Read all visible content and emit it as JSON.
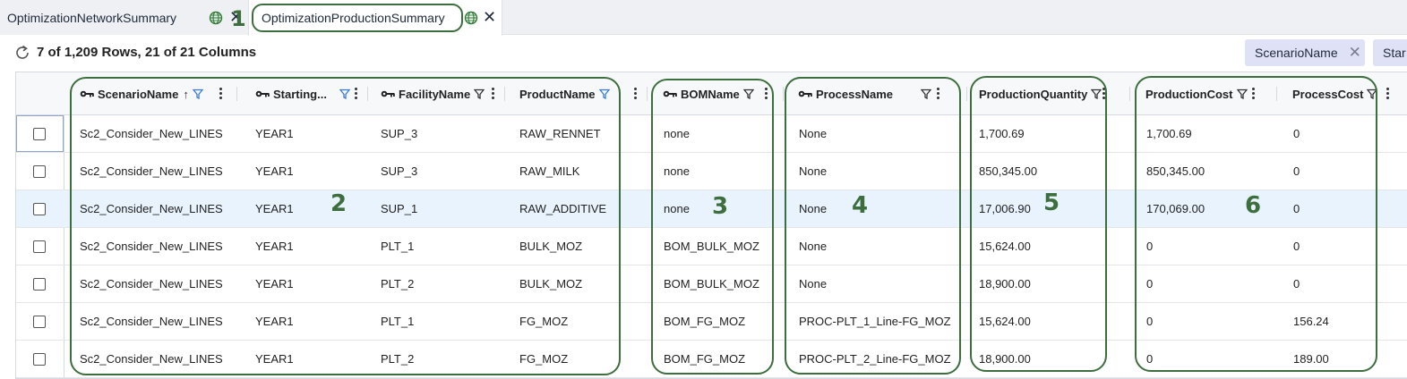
{
  "tabs": [
    {
      "label": "OptimizationNetworkSummary"
    },
    {
      "label": "OptimizationProductionSummary"
    }
  ],
  "toolbar": {
    "row_info": "7 of 1,209 Rows, 21 of 21 Columns",
    "chips": [
      {
        "label": "ScenarioName"
      },
      {
        "label": "Star"
      }
    ]
  },
  "grid": {
    "columns": [
      {
        "label": "ScenarioName"
      },
      {
        "label": "Starting..."
      },
      {
        "label": "FacilityName"
      },
      {
        "label": "ProductName"
      },
      {
        "label": "BOMName"
      },
      {
        "label": "ProcessName"
      },
      {
        "label": "ProductionQuantity"
      },
      {
        "label": "ProductionCost"
      },
      {
        "label": "ProcessCost"
      }
    ],
    "rows": [
      {
        "cells": [
          "Sc2_Consider_New_LINES",
          "YEAR1",
          "SUP_3",
          "RAW_RENNET",
          "none",
          "None",
          "1,700.69",
          "1,700.69",
          "0"
        ]
      },
      {
        "cells": [
          "Sc2_Consider_New_LINES",
          "YEAR1",
          "SUP_3",
          "RAW_MILK",
          "none",
          "None",
          "850,345.00",
          "850,345.00",
          "0"
        ]
      },
      {
        "cells": [
          "Sc2_Consider_New_LINES",
          "YEAR1",
          "SUP_1",
          "RAW_ADDITIVE",
          "none",
          "None",
          "17,006.90",
          "170,069.00",
          "0"
        ]
      },
      {
        "cells": [
          "Sc2_Consider_New_LINES",
          "YEAR1",
          "PLT_1",
          "BULK_MOZ",
          "BOM_BULK_MOZ",
          "None",
          "15,624.00",
          "0",
          "0"
        ]
      },
      {
        "cells": [
          "Sc2_Consider_New_LINES",
          "YEAR1",
          "PLT_2",
          "BULK_MOZ",
          "BOM_BULK_MOZ",
          "None",
          "18,900.00",
          "0",
          "0"
        ]
      },
      {
        "cells": [
          "Sc2_Consider_New_LINES",
          "YEAR1",
          "PLT_1",
          "FG_MOZ",
          "BOM_FG_MOZ",
          "PROC-PLT_1_Line-FG_MOZ",
          "15,624.00",
          "0",
          "156.24"
        ]
      },
      {
        "cells": [
          "Sc2_Consider_New_LINES",
          "YEAR1",
          "PLT_2",
          "FG_MOZ",
          "BOM_FG_MOZ",
          "PROC-PLT_2_Line-FG_MOZ",
          "18,900.00",
          "0",
          "189.00"
        ]
      }
    ]
  },
  "annotations": {
    "labels": [
      "1",
      "2",
      "3",
      "4",
      "5",
      "6"
    ],
    "color": "#3d6e3d"
  },
  "colors": {
    "highlight_row": "#e8f3fd",
    "chip_bg": "#dfe1f7",
    "filter_active": "#3a7bd5"
  },
  "icons": [
    "globe-icon",
    "close-icon",
    "refresh-icon",
    "key-icon",
    "filter-icon",
    "sort-up-icon",
    "kebab-menu-icon",
    "checkbox"
  ]
}
